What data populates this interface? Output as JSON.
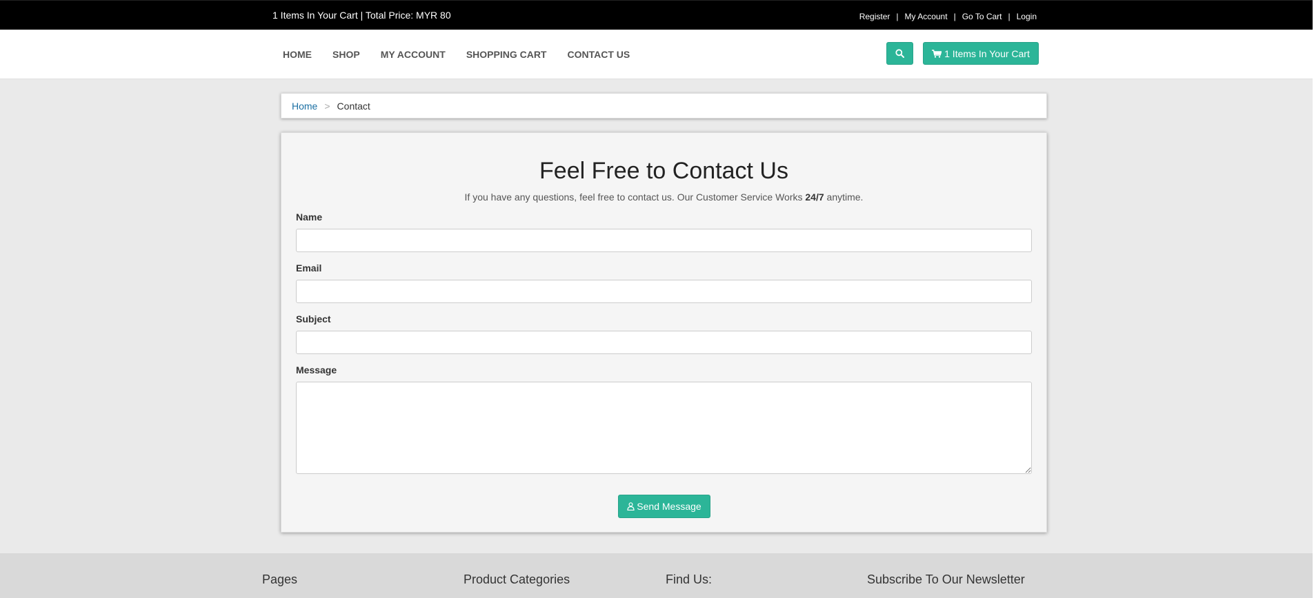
{
  "topbar": {
    "cart_info": "1 Items In Your Cart | Total Price: MYR 80",
    "links": [
      "Register",
      "My Account",
      "Go To Cart",
      "Login"
    ]
  },
  "nav": {
    "items": [
      "HOME",
      "SHOP",
      "MY ACCOUNT",
      "SHOPPING CART",
      "CONTACT US"
    ],
    "search_icon": "search-icon",
    "cart_button_label": "1 Items In Your Cart",
    "accent_color": "#2cb598"
  },
  "breadcrumb": {
    "home": "Home",
    "divider": ">",
    "current": "Contact"
  },
  "contact": {
    "title": "Feel Free to Contact Us",
    "subtitle_before": "If you have any questions, feel free to contact us. Our Customer Service Works ",
    "subtitle_bold": "24/7",
    "subtitle_after": " anytime.",
    "fields": {
      "name_label": "Name",
      "email_label": "Email",
      "subject_label": "Subject",
      "message_label": "Message",
      "name_value": "",
      "email_value": "",
      "subject_value": "",
      "message_value": ""
    },
    "send_label": "Send Message"
  },
  "footer": {
    "pages": "Pages",
    "product_categories": "Product Categories",
    "find_us": "Find Us:",
    "newsletter": "Subscribe To Our Newsletter"
  }
}
